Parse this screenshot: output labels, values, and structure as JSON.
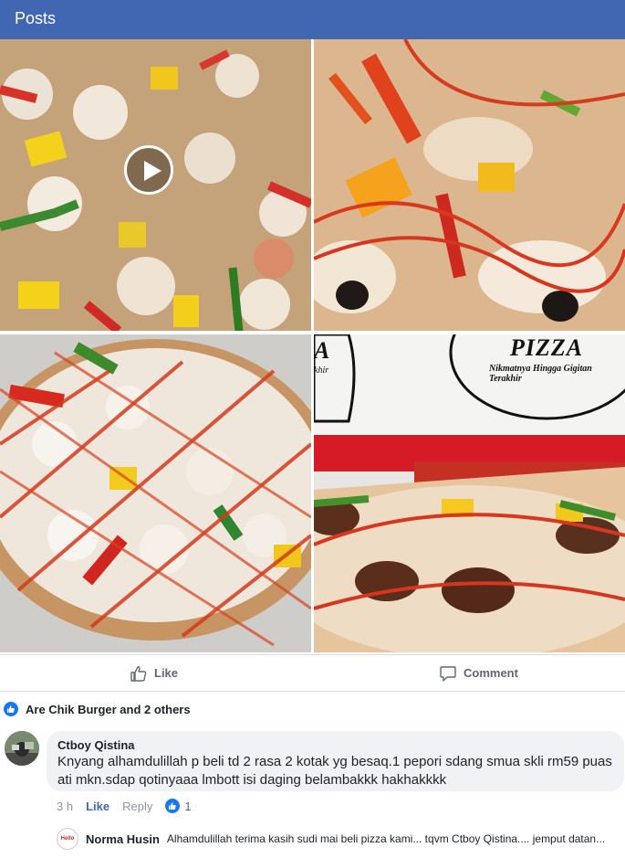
{
  "header": {
    "title": "Posts"
  },
  "actions": {
    "like_label": "Like",
    "comment_label": "Comment"
  },
  "reactions": {
    "summary": "Are Chik Burger and 2 others"
  },
  "comment": {
    "author": "Ctboy Qistina",
    "text": "Knyang alhamdulillah p beli td 2 rasa 2  kotak yg besaq.1 pepori sdang smua skli rm59 puas ati mkn.sdap qotinyaaa lmbott isi daging belambakkk hakhakkkk",
    "time": "3 h",
    "like_label": "Like",
    "reply_label": "Reply",
    "reaction_count": "1"
  },
  "reply": {
    "author": "Norma Husin",
    "text": "Alhamdulillah terima kasih sudi mai beli pizza kami... tqvm Ctboy Qistina.... jemput datan..."
  },
  "photos": {
    "box_logo": "PIZZA",
    "box_tagline": "Nikmatnya Hingga Gigitan Terakhir",
    "box_left_letter": "A",
    "box_left_small": "khir"
  },
  "colors": {
    "header": "#4267b2",
    "accent": "#1877f2"
  }
}
